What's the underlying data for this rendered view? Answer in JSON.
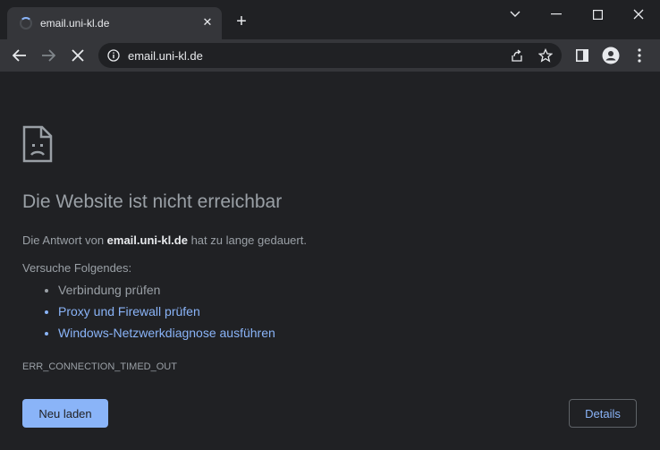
{
  "tab": {
    "title": "email.uni-kl.de",
    "close_glyph": "✕"
  },
  "newtab": {
    "glyph": "+"
  },
  "omnibox": {
    "url": "email.uni-kl.de"
  },
  "error": {
    "heading": "Die Website ist nicht erreichbar",
    "desc_prefix": "Die Antwort von ",
    "desc_host": "email.uni-kl.de",
    "desc_suffix": " hat zu lange gedauert.",
    "try_label": "Versuche Folgendes:",
    "suggestions": [
      "Verbindung prüfen",
      "Proxy und Firewall prüfen",
      "Windows-Netzwerkdiagnose ausführen"
    ],
    "code": "ERR_CONNECTION_TIMED_OUT"
  },
  "buttons": {
    "reload": "Neu laden",
    "details": "Details"
  },
  "colors": {
    "bg": "#202124",
    "toolbar": "#35363a",
    "accent": "#8ab4f8",
    "text": "#9aa0a6"
  }
}
